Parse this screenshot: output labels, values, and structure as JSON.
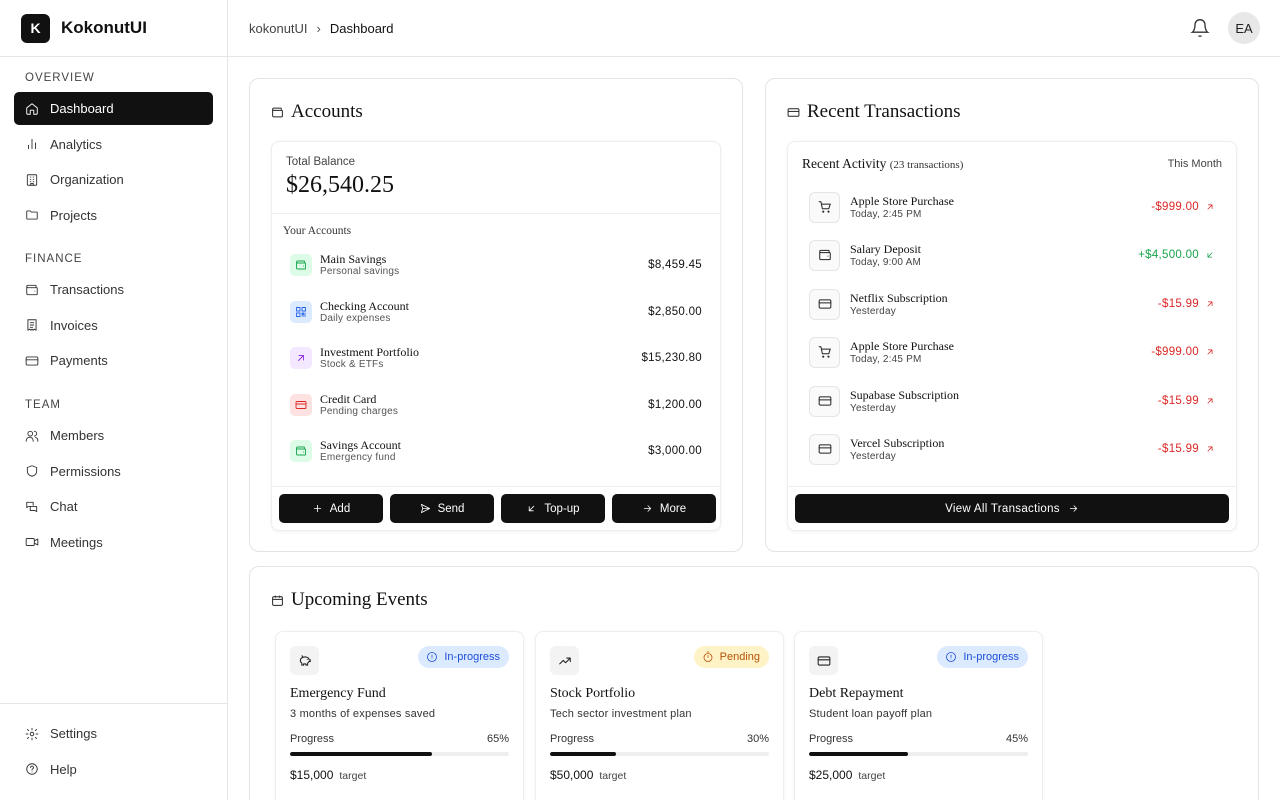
{
  "brand": {
    "logo_letter": "K",
    "name": "KokonutUI"
  },
  "sidebar": {
    "sections": [
      {
        "title": "OVERVIEW",
        "items": [
          {
            "label": "Dashboard",
            "icon": "home-icon",
            "active": true
          },
          {
            "label": "Analytics",
            "icon": "bar-chart-icon"
          },
          {
            "label": "Organization",
            "icon": "building-icon"
          },
          {
            "label": "Projects",
            "icon": "folder-icon"
          }
        ]
      },
      {
        "title": "FINANCE",
        "items": [
          {
            "label": "Transactions",
            "icon": "wallet-icon"
          },
          {
            "label": "Invoices",
            "icon": "receipt-icon"
          },
          {
            "label": "Payments",
            "icon": "credit-card-icon"
          }
        ]
      },
      {
        "title": "TEAM",
        "items": [
          {
            "label": "Members",
            "icon": "users-icon"
          },
          {
            "label": "Permissions",
            "icon": "shield-icon"
          },
          {
            "label": "Chat",
            "icon": "chat-icon"
          },
          {
            "label": "Meetings",
            "icon": "video-icon"
          }
        ]
      }
    ],
    "bottom": [
      {
        "label": "Settings",
        "icon": "gear-icon"
      },
      {
        "label": "Help",
        "icon": "help-icon"
      }
    ]
  },
  "header": {
    "breadcrumb": [
      "kokonutUI",
      "Dashboard"
    ],
    "avatar_initials": "EA"
  },
  "accounts": {
    "title": "Accounts",
    "total_label": "Total Balance",
    "total_value": "$26,540.25",
    "list_label": "Your Accounts",
    "items": [
      {
        "name": "Main Savings",
        "desc": "Personal savings",
        "amount": "$8,459.45",
        "color": "#16a34a",
        "bg": "#dcfce7",
        "icon": "wallet-icon"
      },
      {
        "name": "Checking Account",
        "desc": "Daily expenses",
        "amount": "$2,850.00",
        "color": "#2563eb",
        "bg": "#dbeafe",
        "icon": "qr-code-icon"
      },
      {
        "name": "Investment Portfolio",
        "desc": "Stock & ETFs",
        "amount": "$15,230.80",
        "color": "#9333ea",
        "bg": "#f3e8ff",
        "icon": "arrow-up-right-icon"
      },
      {
        "name": "Credit Card",
        "desc": "Pending charges",
        "amount": "$1,200.00",
        "color": "#dc2626",
        "bg": "#fee2e2",
        "icon": "credit-card-icon"
      },
      {
        "name": "Savings Account",
        "desc": "Emergency fund",
        "amount": "$3,000.00",
        "color": "#16a34a",
        "bg": "#dcfce7",
        "icon": "wallet-icon"
      }
    ],
    "buttons": [
      "Add",
      "Send",
      "Top-up",
      "More"
    ]
  },
  "transactions": {
    "title": "Recent Transactions",
    "activity_label": "Recent Activity",
    "activity_count": "(23 transactions)",
    "period": "This Month",
    "items": [
      {
        "name": "Apple Store Purchase",
        "time": "Today, 2:45 PM",
        "amount": "-$999.00",
        "type": "out",
        "icon": "cart-icon"
      },
      {
        "name": "Salary Deposit",
        "time": "Today, 9:00 AM",
        "amount": "+$4,500.00",
        "type": "in",
        "icon": "wallet-icon"
      },
      {
        "name": "Netflix Subscription",
        "time": "Yesterday",
        "amount": "-$15.99",
        "type": "out",
        "icon": "credit-card-icon"
      },
      {
        "name": "Apple Store Purchase",
        "time": "Today, 2:45 PM",
        "amount": "-$999.00",
        "type": "out",
        "icon": "cart-icon"
      },
      {
        "name": "Supabase Subscription",
        "time": "Yesterday",
        "amount": "-$15.99",
        "type": "out",
        "icon": "credit-card-icon"
      },
      {
        "name": "Vercel Subscription",
        "time": "Yesterday",
        "amount": "-$15.99",
        "type": "out",
        "icon": "credit-card-icon"
      }
    ],
    "view_all": "View All Transactions"
  },
  "events": {
    "title": "Upcoming Events",
    "items": [
      {
        "title": "Emergency Fund",
        "desc": "3 months of expenses saved",
        "status": "In-progress",
        "status_color": "blue",
        "icon": "piggy-bank-icon",
        "progress_label": "Progress",
        "progress": 65,
        "progress_text": "65%",
        "target": "$15,000",
        "target_label": "target"
      },
      {
        "title": "Stock Portfolio",
        "desc": "Tech sector investment plan",
        "status": "Pending",
        "status_color": "amber",
        "icon": "trending-up-icon",
        "progress_label": "Progress",
        "progress": 30,
        "progress_text": "30%",
        "target": "$50,000",
        "target_label": "target"
      },
      {
        "title": "Debt Repayment",
        "desc": "Student loan payoff plan",
        "status": "In-progress",
        "status_color": "blue",
        "icon": "credit-card-icon",
        "progress_label": "Progress",
        "progress": 45,
        "progress_text": "45%",
        "target": "$25,000",
        "target_label": "target"
      }
    ]
  }
}
